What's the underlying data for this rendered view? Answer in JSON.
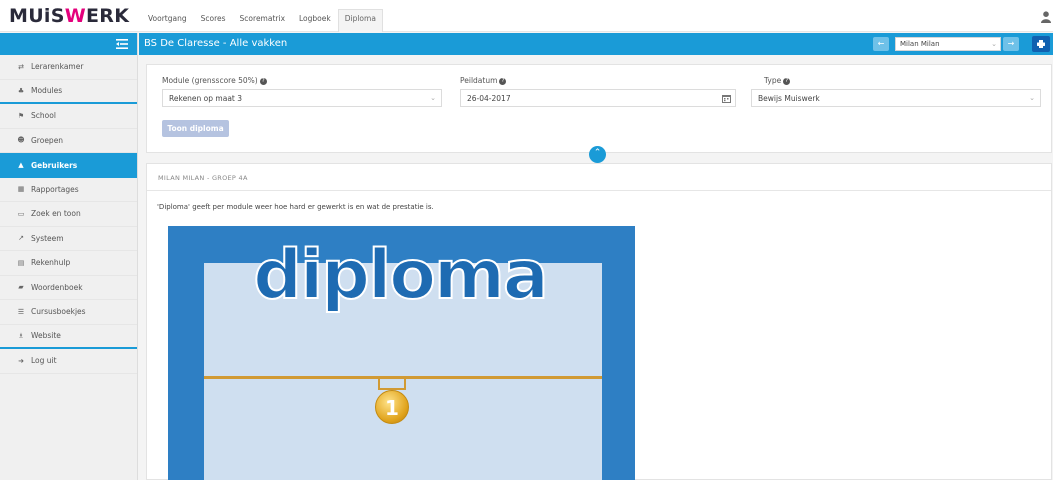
{
  "app": {
    "logo_left": "MUiS",
    "logo_accent": "W",
    "logo_right": "ERK"
  },
  "nav": {
    "tabs": [
      {
        "label": "Voortgang"
      },
      {
        "label": "Scores"
      },
      {
        "label": "Scorematrix"
      },
      {
        "label": "Logboek"
      },
      {
        "label": "Diploma",
        "active": true
      }
    ]
  },
  "sidebar": {
    "items": [
      {
        "label": "Lerarenkamer",
        "icon": "swap-icon"
      },
      {
        "label": "Modules",
        "icon": "sitemap-icon"
      },
      {
        "label": "School",
        "icon": "flag-icon"
      },
      {
        "label": "Groepen",
        "icon": "group-icon"
      },
      {
        "label": "Gebruikers",
        "icon": "user-icon",
        "active": true
      },
      {
        "label": "Rapportages",
        "icon": "table-icon"
      },
      {
        "label": "Zoek en toon",
        "icon": "monitor-icon"
      },
      {
        "label": "Systeem",
        "icon": "chart-icon"
      },
      {
        "label": "Rekenhulp",
        "icon": "calculator-icon"
      },
      {
        "label": "Woordenboek",
        "icon": "book-icon"
      },
      {
        "label": "Cursusboekjes",
        "icon": "list-icon"
      },
      {
        "label": "Website",
        "icon": "network-icon"
      },
      {
        "label": "Log uit",
        "icon": "logout-icon"
      }
    ]
  },
  "header": {
    "title": "BS De Claresse - Alle vakken",
    "user_select": "Milan Milan"
  },
  "filters": {
    "module_label": "Module (grensscore 50%)",
    "module_value": "Rekenen op maat 3",
    "date_label": "Peildatum",
    "date_value": "26-04-2017",
    "type_label": "Type",
    "type_value": "Bewijs Muiswerk",
    "submit_label": "Toon diploma"
  },
  "content": {
    "heading": "MILAN MILAN - GROEP 4A",
    "description": "'Diploma' geeft per module weer hoe hard er gewerkt is en wat de prestatie is.",
    "diploma_word": "diploma",
    "medal_number": "1"
  },
  "colors": {
    "accent": "#1a9bd7",
    "brand_pink": "#e4007c",
    "print_button": "#1060b0"
  }
}
